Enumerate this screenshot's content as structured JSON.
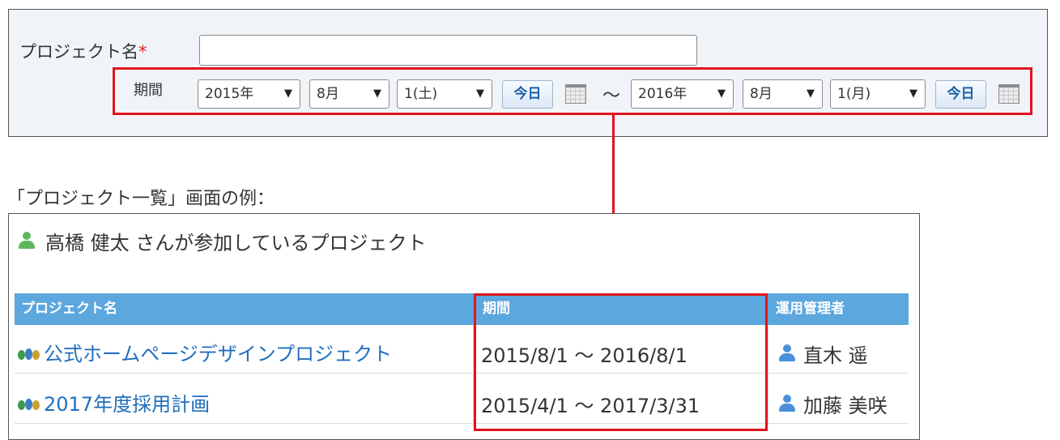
{
  "form": {
    "project_name_label": "プロジェクト名",
    "required_mark": "*",
    "project_name_value": "",
    "period_label": "期間",
    "start": {
      "year": "2015年",
      "month": "8月",
      "day": "1(土)",
      "today_label": "今日"
    },
    "separator": "～",
    "end": {
      "year": "2016年",
      "month": "8月",
      "day": "1(月)",
      "today_label": "今日"
    }
  },
  "caption": "「プロジェクト一覧」画面の例：",
  "list": {
    "heading": "高橋 健太 さんが参加しているプロジェクト",
    "columns": [
      "プロジェクト名",
      "期間",
      "運用管理者"
    ],
    "rows": [
      {
        "name": "公式ホームページデザインプロジェクト",
        "period": "2015/8/1 ～ 2016/8/1",
        "manager": "直木 遥"
      },
      {
        "name": "2017年度採用計画",
        "period": "2015/4/1 ～ 2017/3/31",
        "manager": "加藤 美咲"
      }
    ]
  },
  "colors": {
    "highlight": "#e0141e",
    "header_bg": "#5ba7de",
    "link": "#1f6fbd"
  }
}
